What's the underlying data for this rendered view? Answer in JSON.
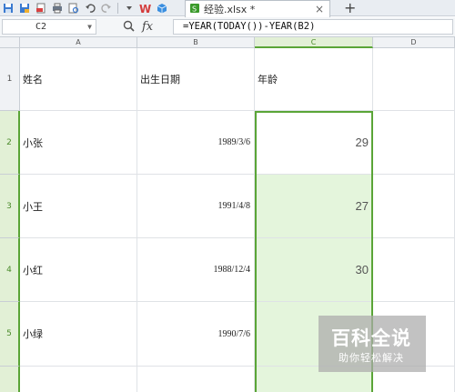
{
  "toolbar": {
    "icons": [
      "save-icon",
      "save-as-icon",
      "export-pdf-icon",
      "print-icon",
      "print-preview-icon",
      "undo-icon",
      "redo-icon",
      "dropdown-icon",
      "wps-logo-icon",
      "cube-icon"
    ]
  },
  "tab": {
    "file_name": "经验.xlsx *",
    "close": "×",
    "add": "+"
  },
  "formula_bar": {
    "cell_ref": "C2",
    "fx": "fx",
    "formula": "=YEAR(TODAY())-YEAR(B2)"
  },
  "columns": [
    "A",
    "B",
    "C",
    "D"
  ],
  "rows": [
    {
      "num": "1",
      "name": "姓名",
      "birth": "出生日期",
      "age": "年龄"
    },
    {
      "num": "2",
      "name": "小张",
      "birth": "1989/3/6",
      "age": "29"
    },
    {
      "num": "3",
      "name": "小王",
      "birth": "1991/4/8",
      "age": "27"
    },
    {
      "num": "4",
      "name": "小红",
      "birth": "1988/12/4",
      "age": "30"
    },
    {
      "num": "5",
      "name": "小绿",
      "birth": "1990/7/6",
      "age": ""
    }
  ],
  "watermark": {
    "title": "百科全说",
    "subtitle": "助你轻松解决"
  },
  "colors": {
    "selection_green": "#5aa537",
    "selection_fill": "#e4f5dc",
    "brand_green": "#3a9a2a"
  }
}
